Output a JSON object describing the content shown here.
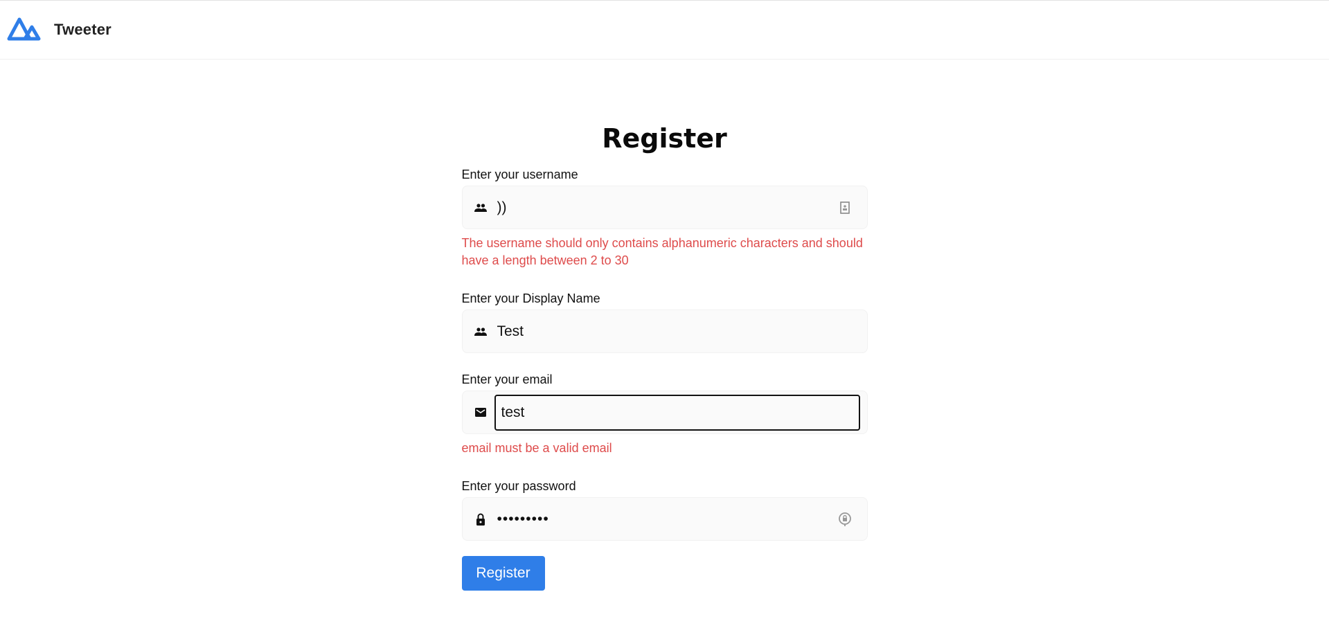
{
  "app": {
    "brand": "Tweeter",
    "accent_color": "#2f7ee8",
    "error_color": "#de4b4b"
  },
  "form": {
    "title": "Register",
    "username": {
      "label": "Enter your username",
      "value": "))",
      "icon": "people-icon",
      "trailing_icon": "contact-card-icon",
      "error": "The username should only contains alphanumeric characters and should have a length between 2 to 30"
    },
    "display_name": {
      "label": "Enter your Display Name",
      "value": "Test",
      "icon": "people-icon"
    },
    "email": {
      "label": "Enter your email",
      "value": "test",
      "icon": "mail-icon",
      "error": "email must be a valid email"
    },
    "password": {
      "label": "Enter your password",
      "value": "•••••••••",
      "icon": "lock-icon",
      "trailing_icon": "password-manager-icon"
    },
    "submit_label": "Register"
  }
}
